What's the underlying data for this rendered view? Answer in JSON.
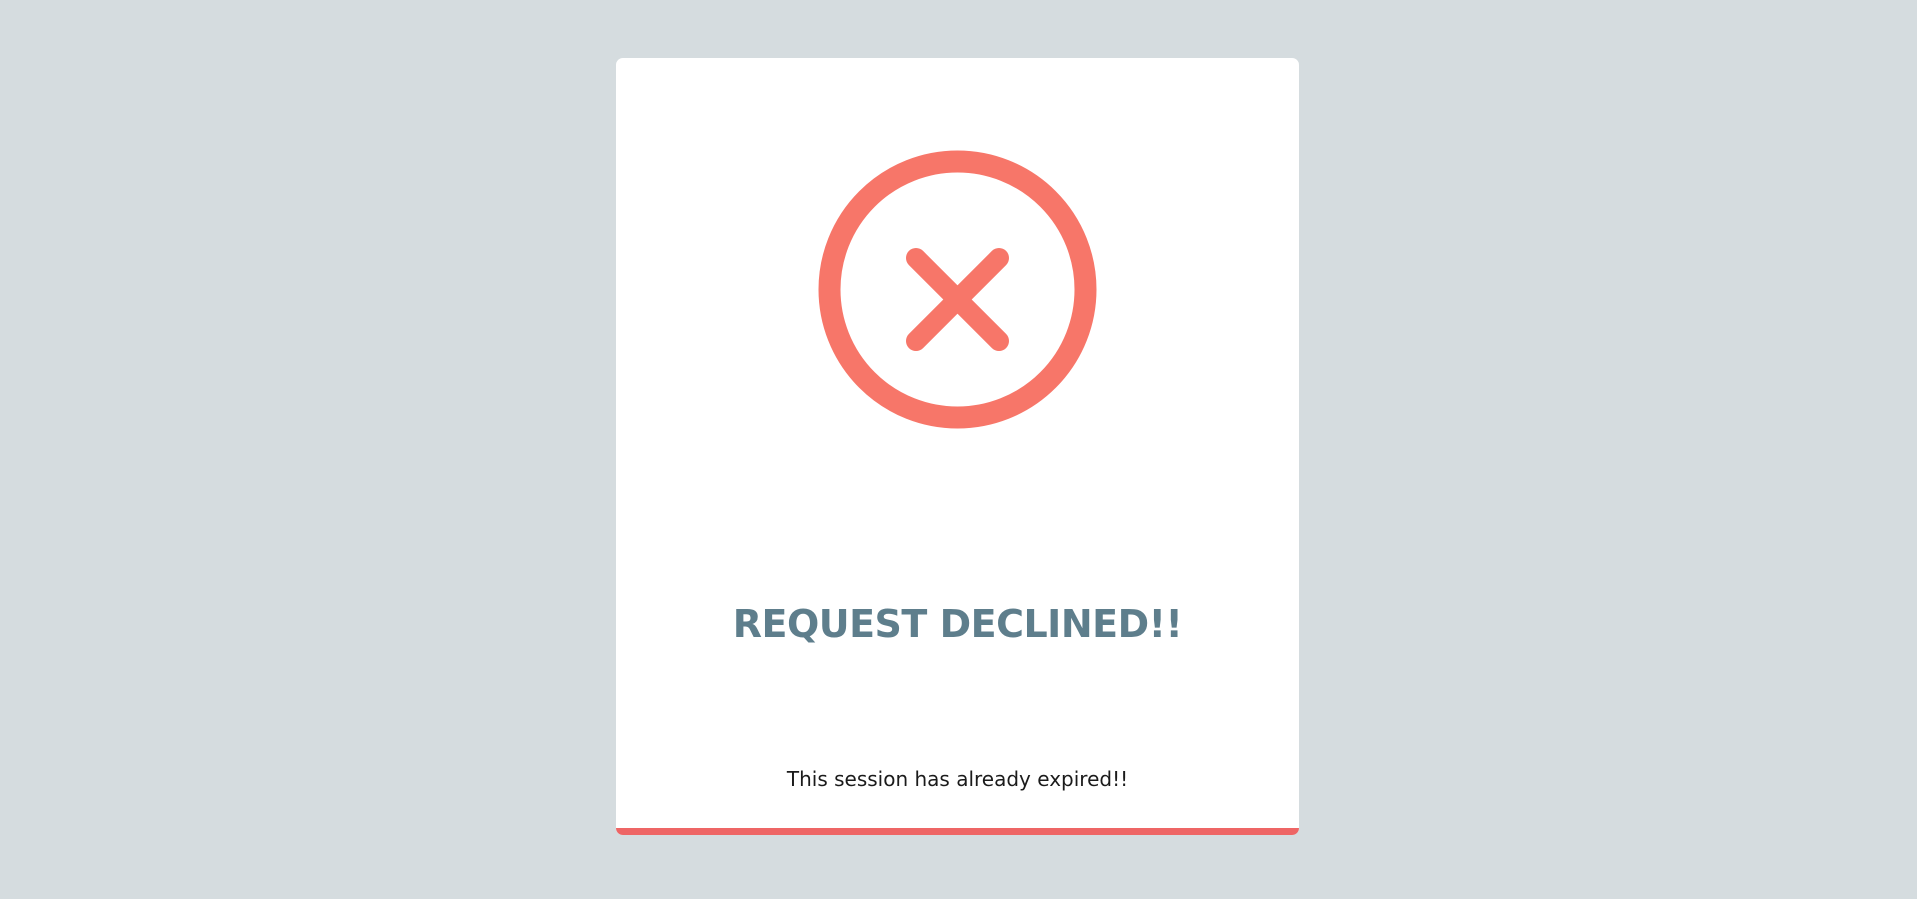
{
  "page": {
    "background_color": "#d5dcdf"
  },
  "card": {
    "accent_color": "#ee6565",
    "icon": {
      "name": "close-circle-icon",
      "color": "#f77669"
    },
    "title": "REQUEST DECLINED!!",
    "title_color": "#5e7e8c",
    "message": "This session has already expired!!"
  }
}
